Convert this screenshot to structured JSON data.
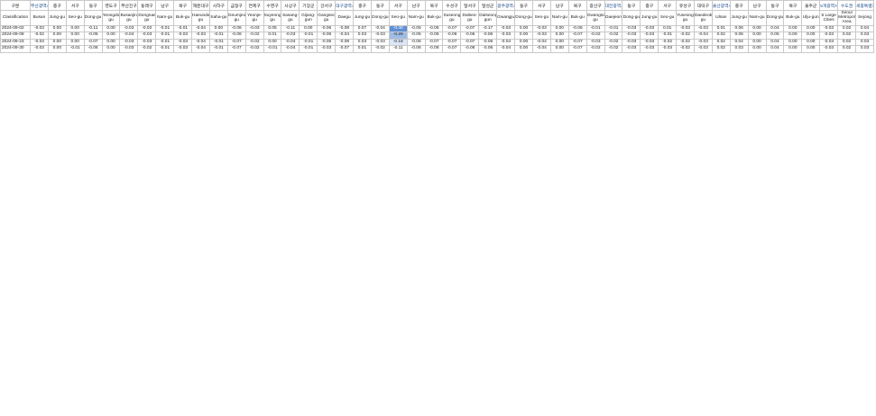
{
  "header": {
    "corner_ko": "구분",
    "corner_en": "Classification",
    "columns": [
      {
        "ko": "부산광역시",
        "en": "Busan",
        "group": true
      },
      {
        "ko": "중구",
        "en": "Jung-gu"
      },
      {
        "ko": "서구",
        "en": "Seo-gu"
      },
      {
        "ko": "동구",
        "en": "Dong-gu"
      },
      {
        "ko": "영도구",
        "en": "Yeongdo-gu"
      },
      {
        "ko": "부산진구",
        "en": "Busanjin-gu"
      },
      {
        "ko": "동래구",
        "en": "Dongnae-gu"
      },
      {
        "ko": "남구",
        "en": "Nam-gu"
      },
      {
        "ko": "북구",
        "en": "Buk-gu"
      },
      {
        "ko": "해운대구",
        "en": "Haeundae-gu"
      },
      {
        "ko": "사하구",
        "en": "Saha-gu"
      },
      {
        "ko": "금정구",
        "en": "Geumjeong-gu"
      },
      {
        "ko": "연제구",
        "en": "Yeonje-gu"
      },
      {
        "ko": "수영구",
        "en": "Suyeong-gu"
      },
      {
        "ko": "사상구",
        "en": "Sasang-gu"
      },
      {
        "ko": "기장군",
        "en": "Gijang-gun"
      },
      {
        "ko": "강서구",
        "en": "Gangseo-gu"
      },
      {
        "ko": "대구광역시",
        "en": "Daegu",
        "group": true,
        "sep": true
      },
      {
        "ko": "중구",
        "en": "Jung-gu"
      },
      {
        "ko": "동구",
        "en": "Dong-gu"
      },
      {
        "ko": "서구",
        "en": "Seo-gu"
      },
      {
        "ko": "남구",
        "en": "Nam-gu"
      },
      {
        "ko": "북구",
        "en": "Buk-gu"
      },
      {
        "ko": "수성구",
        "en": "Suseong-gu"
      },
      {
        "ko": "달서구",
        "en": "Dalseo-gu"
      },
      {
        "ko": "달성군",
        "en": "Dalseong-gun"
      },
      {
        "ko": "광주광역시",
        "en": "Gwangju",
        "group": true,
        "sep": true
      },
      {
        "ko": "동구",
        "en": "Dong-gu"
      },
      {
        "ko": "서구",
        "en": "Seo-gu"
      },
      {
        "ko": "남구",
        "en": "Nam-gu"
      },
      {
        "ko": "북구",
        "en": "Buk-gu"
      },
      {
        "ko": "광산구",
        "en": "Gwangsan-gu"
      },
      {
        "ko": "대전광역시",
        "en": "Daejeon",
        "group": true,
        "sep": true
      },
      {
        "ko": "동구",
        "en": "Dong-gu"
      },
      {
        "ko": "중구",
        "en": "Jung-gu"
      },
      {
        "ko": "서구",
        "en": "Seo-gu"
      },
      {
        "ko": "유성구",
        "en": "Yuseong-gu"
      },
      {
        "ko": "대덕구",
        "en": "Daedeok-gu"
      },
      {
        "ko": "울산광역시",
        "en": "Ulsan",
        "group": true,
        "sep": true
      },
      {
        "ko": "중구",
        "en": "Jung-gu"
      },
      {
        "ko": "남구",
        "en": "Nam-gu"
      },
      {
        "ko": "동구",
        "en": "Dong-gu"
      },
      {
        "ko": "북구",
        "en": "Buk-gu"
      },
      {
        "ko": "울주군",
        "en": "Ulju-gun"
      },
      {
        "ko": "5개광역시",
        "en": "5 Large Cities",
        "group": true,
        "sep": true
      },
      {
        "ko": "수도권",
        "en": "Seoul Metropolitan Area",
        "group": true
      },
      {
        "ko": "세종특별자치시",
        "en": "Sejong",
        "group": true
      }
    ]
  },
  "rows": [
    {
      "date": "2024-09-02",
      "v": [
        "-0.03",
        "0.00",
        "0.00",
        "-0.11",
        "0.00",
        "-0.03",
        "-0.02",
        "-0.01",
        "-0.01",
        "-0.04",
        "0.00",
        "-0.06",
        "-0.03",
        "0.05",
        "-0.11",
        "0.00",
        "-0.06",
        "-0.08",
        "0.07",
        "-0.04",
        "-0.40",
        "-0.05",
        "-0.06",
        "-0.07",
        "-0.07",
        "-0.17",
        "-0.03",
        "0.00",
        "-0.03",
        "0.00",
        "-0.06",
        "-0.01",
        "-0.01",
        "-0.03",
        "-0.03",
        "0.01",
        "-0.03",
        "-0.03",
        "0.01",
        "0.06",
        "0.00",
        "0.04",
        "0.00",
        "0.00",
        "-0.03",
        "0.02",
        "0.04"
      ]
    },
    {
      "date": "2024-09-09",
      "v": [
        "-0.02",
        "0.00",
        "0.00",
        "-0.05",
        "0.00",
        "-0.04",
        "-0.03",
        "-0.01",
        "-0.03",
        "-0.03",
        "-0.01",
        "-0.06",
        "-0.02",
        "0.01",
        "-0.03",
        "-0.01",
        "-0.06",
        "-0.04",
        "0.03",
        "-0.03",
        "-0.29",
        "-0.05",
        "-0.05",
        "-0.06",
        "-0.06",
        "-0.06",
        "-0.03",
        "0.00",
        "-0.03",
        "0.00",
        "-0.07",
        "-0.02",
        "-0.02",
        "-0.03",
        "-0.03",
        "-0.01",
        "-0.02",
        "-0.04",
        "0.02",
        "0.06",
        "0.00",
        "0.05",
        "0.00",
        "0.00",
        "-0.03",
        "0.02",
        "0.03"
      ]
    },
    {
      "date": "2024-09-23",
      "v": [
        "-0.03",
        "0.00",
        "0.00",
        "-0.07",
        "0.00",
        "-0.03",
        "-0.03",
        "-0.01",
        "-0.03",
        "-0.04",
        "-0.01",
        "-0.07",
        "-0.02",
        "0.00",
        "-0.04",
        "-0.01",
        "-0.05",
        "-0.08",
        "0.03",
        "-0.03",
        "-0.18",
        "-0.06",
        "-0.07",
        "-0.07",
        "-0.07",
        "-0.05",
        "-0.04",
        "0.00",
        "-0.04",
        "0.00",
        "-0.07",
        "-0.03",
        "-0.02",
        "-0.03",
        "-0.03",
        "-0.02",
        "-0.02",
        "-0.03",
        "0.02",
        "0.04",
        "0.00",
        "0.04",
        "0.00",
        "0.00",
        "-0.03",
        "0.02",
        "0.03"
      ]
    },
    {
      "date": "2024-09-30",
      "v": [
        "-0.03",
        "0.00",
        "-0.01",
        "-0.06",
        "0.00",
        "-0.03",
        "-0.02",
        "-0.01",
        "-0.03",
        "-0.04",
        "-0.01",
        "-0.07",
        "-0.02",
        "-0.01",
        "-0.04",
        "-0.01",
        "-0.03",
        "-0.07",
        "0.01",
        "-0.02",
        "-0.11",
        "-0.06",
        "-0.08",
        "-0.07",
        "-0.06",
        "-0.06",
        "-0.04",
        "0.00",
        "-0.04",
        "0.00",
        "-0.07",
        "-0.02",
        "-0.02",
        "-0.03",
        "-0.03",
        "-0.03",
        "-0.02",
        "-0.03",
        "0.02",
        "0.03",
        "0.00",
        "0.04",
        "0.00",
        "0.00",
        "-0.03",
        "0.02",
        "0.03"
      ]
    }
  ]
}
